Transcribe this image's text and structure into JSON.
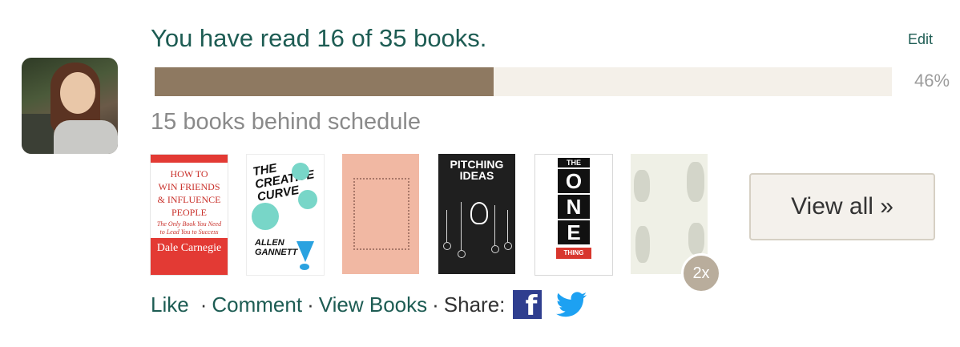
{
  "header": {
    "title": "You have read 16 of 35 books.",
    "edit_label": "Edit"
  },
  "progress": {
    "read": 16,
    "total": 35,
    "percent_label": "46%",
    "fraction": 0.46,
    "status": "15 books behind schedule"
  },
  "books": [
    {
      "title_lines": [
        "HOW TO",
        "WIN FRIENDS",
        "& INFLUENCE",
        "PEOPLE"
      ],
      "subtitle": "The Only Book You Need to Lead You to Success",
      "author": "Dale Carnegie"
    },
    {
      "title": "THE CREATIVE CURVE",
      "author": "ALLEN GANNETT"
    },
    {
      "title": "book-3-cover"
    },
    {
      "title": "PITCHING IDEAS"
    },
    {
      "title_lines": [
        "THE",
        "O",
        "N",
        "E",
        "THING"
      ]
    },
    {
      "title": "book-6-cover"
    }
  ],
  "repeat_badge": "2x",
  "view_all_label": "View all »",
  "actions": {
    "like": "Like",
    "comment": "Comment",
    "view_books": "View Books",
    "share_label": "Share:",
    "separator": "·"
  },
  "icons": {
    "facebook": "facebook-icon",
    "twitter": "twitter-icon"
  },
  "colors": {
    "accent": "#1d5c53",
    "progress_fill": "#8e7961",
    "progress_track": "#f4f0e9",
    "facebook": "#2f3e8f",
    "twitter": "#1da1f2"
  }
}
